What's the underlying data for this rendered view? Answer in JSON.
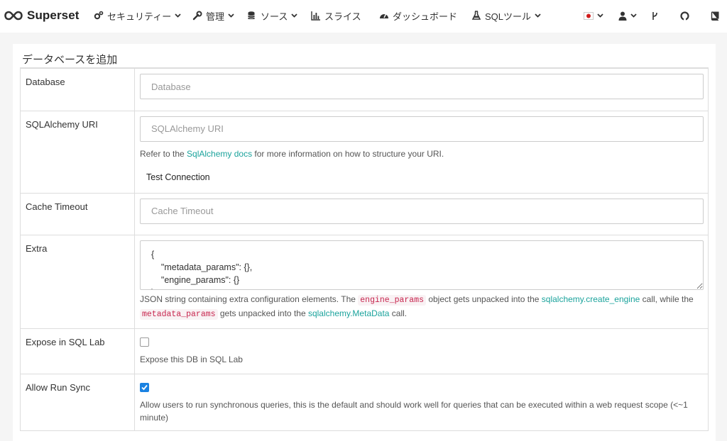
{
  "app": {
    "name": "Superset"
  },
  "nav": {
    "security": "セキュリティー",
    "manage": "管理",
    "sources": "ソース",
    "slices": "スライス",
    "dashboards": "ダッシュボード",
    "sql_tools": "SQLツール"
  },
  "panel": {
    "title": "データベースを追加"
  },
  "form": {
    "database": {
      "label": "Database",
      "placeholder": "Database"
    },
    "sqlalchemy_uri": {
      "label": "SQLAlchemy URI",
      "placeholder": "SQLAlchemy URI",
      "help_before": "Refer to the ",
      "help_link": "SqlAlchemy docs",
      "help_after": " for more information on how to structure your URI.",
      "test_button": "Test Connection"
    },
    "cache_timeout": {
      "label": "Cache Timeout",
      "placeholder": "Cache Timeout"
    },
    "extra": {
      "label": "Extra",
      "value": "{\n    \"metadata_params\": {},\n    \"engine_params\": {}\n}",
      "help_1": "JSON string containing extra configuration elements. The ",
      "code_1": "engine_params",
      "help_2": " object gets unpacked into the ",
      "link_1": "sqlalchemy.create_engine",
      "help_3": " call, while the ",
      "code_2": "metadata_params",
      "help_4": " gets unpacked into the ",
      "link_2": "sqlalchemy.MetaData",
      "help_5": " call."
    },
    "expose_in_sqllab": {
      "label": "Expose in SQL Lab",
      "checked": false,
      "help": "Expose this DB in SQL Lab"
    },
    "allow_run_sync": {
      "label": "Allow Run Sync",
      "checked": true,
      "help": "Allow users to run synchronous queries, this is the default and should work well for queries that can be executed within a web request scope (<~1 minute)"
    }
  },
  "colors": {
    "accent_link": "#1ba39c",
    "checkbox_blue": "#1a82e2",
    "code_red": "#c7254e"
  }
}
